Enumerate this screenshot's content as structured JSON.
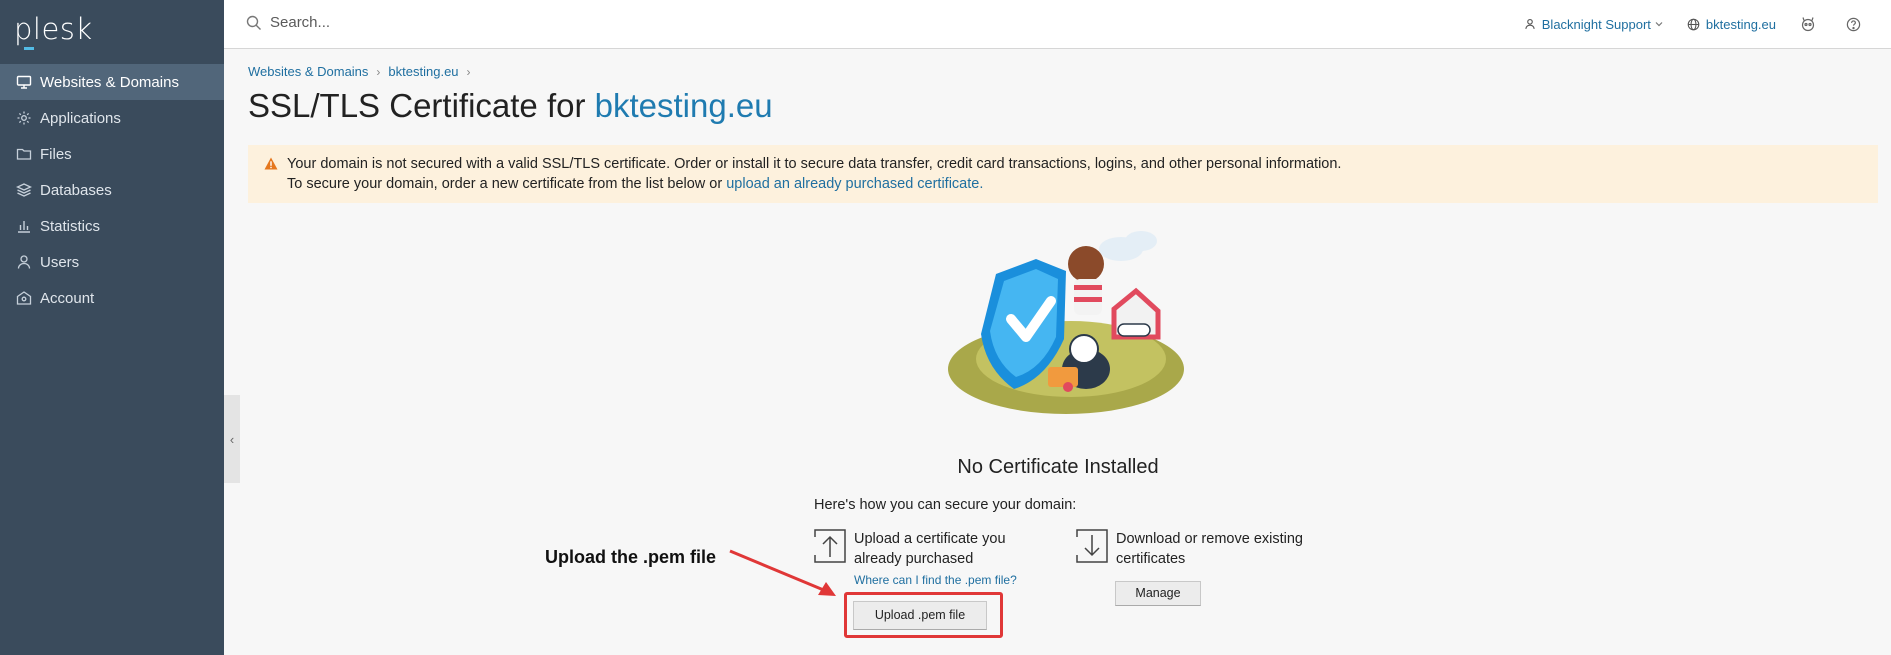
{
  "sidebar": {
    "logo": "plesk",
    "items": [
      {
        "label": "Websites & Domains",
        "icon": "monitor-icon"
      },
      {
        "label": "Applications",
        "icon": "gear-icon"
      },
      {
        "label": "Files",
        "icon": "folder-icon"
      },
      {
        "label": "Databases",
        "icon": "database-layers-icon"
      },
      {
        "label": "Statistics",
        "icon": "bar-chart-icon"
      },
      {
        "label": "Users",
        "icon": "user-icon"
      },
      {
        "label": "Account",
        "icon": "account-icon"
      }
    ]
  },
  "topbar": {
    "search_placeholder": "Search...",
    "user": "Blacknight Support",
    "domain": "bktesting.eu"
  },
  "breadcrumb": [
    "Websites & Domains",
    "bktesting.eu"
  ],
  "page": {
    "title_prefix": "SSL/TLS Certificate for ",
    "title_domain": "bktesting.eu"
  },
  "alert": {
    "line1": "Your domain is not secured with a valid SSL/TLS certificate. Order or install it to secure data transfer, credit card transactions, logins, and other personal information.",
    "line2_prefix": "To secure your domain, order a new certificate from the list below or ",
    "line2_link": "upload an already purchased certificate."
  },
  "content": {
    "heading": "No Certificate Installed",
    "howto": "Here's how you can secure your domain:",
    "option_upload": {
      "text": "Upload a certificate you already purchased",
      "link": "Where can I find the .pem file?",
      "button": "Upload .pem file"
    },
    "option_manage": {
      "text": "Download or remove existing certificates",
      "button": "Manage"
    }
  },
  "annotation": {
    "text": "Upload the .pem file",
    "color": "#e03737"
  }
}
